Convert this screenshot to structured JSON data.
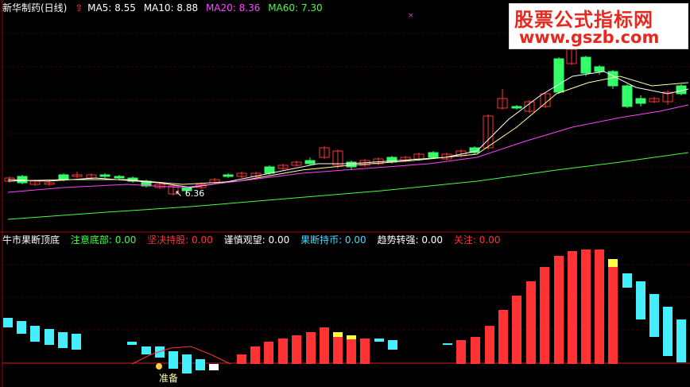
{
  "main_chart": {
    "stock_name": "新华制药(日线)",
    "ma": [
      {
        "label": "MA5: 8.55",
        "color": "#ffffff"
      },
      {
        "label": "MA10: 8.88",
        "color": "#ffffff"
      },
      {
        "label": "MA20: 8.36",
        "color": "#ff44ff"
      },
      {
        "label": "MA60: 7.30",
        "color": "#44ff44"
      }
    ],
    "low_label": "6.36"
  },
  "sub_chart": {
    "title": "牛市果断顶底",
    "indicators": [
      {
        "label": "注意底部: 0.00",
        "color": "#44ff44"
      },
      {
        "label": "坚决持股: 0.00",
        "color": "#ff3333"
      },
      {
        "label": "谨慎观望: 0.00",
        "color": "#ffffff"
      },
      {
        "label": "果断持币: 0.00",
        "color": "#44ddff"
      },
      {
        "label": "趋势转强: 0.00",
        "color": "#ffffff"
      },
      {
        "label": "关注: 0.00",
        "color": "#ff3333"
      }
    ],
    "signal_label": "准备"
  },
  "watermark": {
    "line1": "股票公式指标网",
    "line2": "www.gszb.com"
  },
  "colors": {
    "up": "#ff3333",
    "down": "#33ff66",
    "cyan": "#44eeff",
    "yellow": "#ffff44"
  }
}
